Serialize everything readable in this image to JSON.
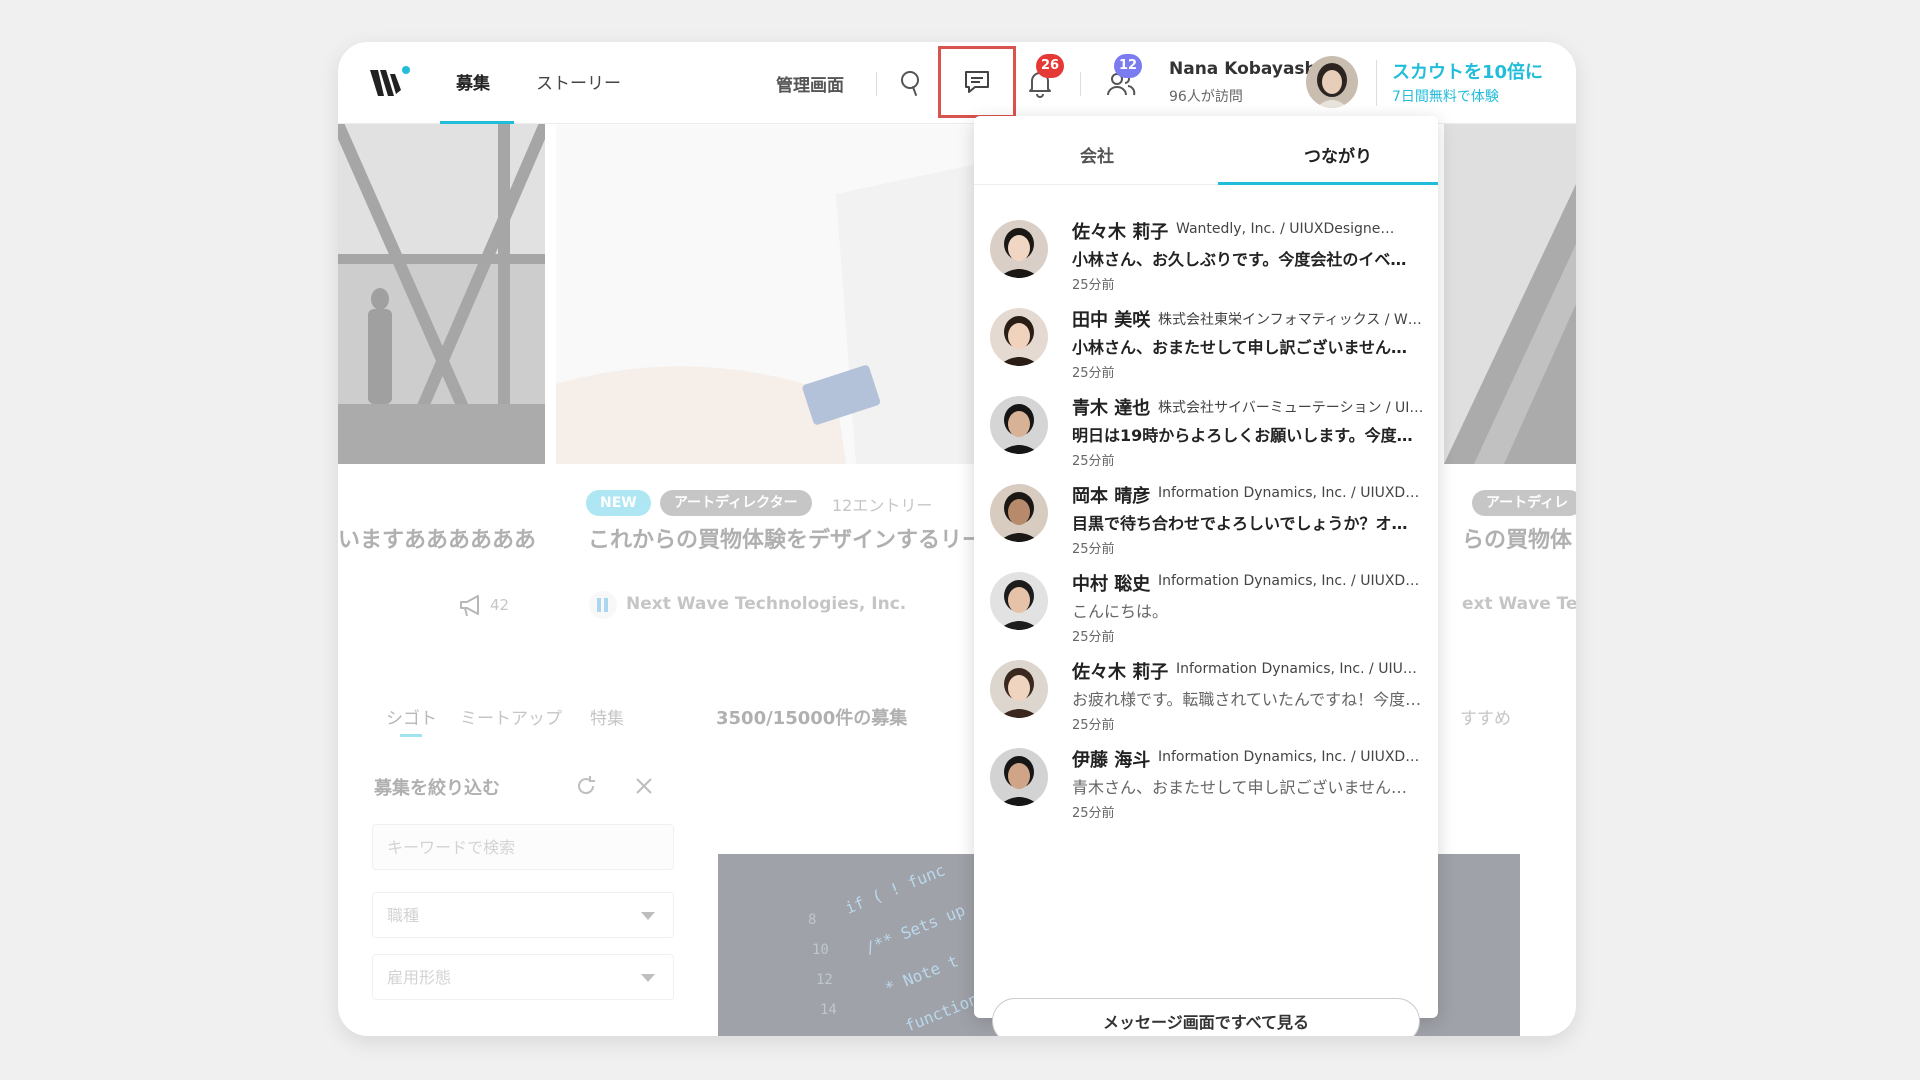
{
  "header": {
    "nav": [
      {
        "label": "募集"
      },
      {
        "label": "ストーリー"
      }
    ],
    "admin_label": "管理画面",
    "notifications_count": "26",
    "connections_count": "12",
    "user": {
      "name": "Nana Kobayashi",
      "visits": "96人が訪問"
    },
    "scout": {
      "title": "スカウトを10倍に",
      "subtitle": "7日間無料で体験"
    },
    "accent_color": "#21bddb",
    "badge_red": "#e53935",
    "badge_purple": "#7b7cf0",
    "highlight_color": "#d9534f"
  },
  "background": {
    "left_card": {
      "title": "いますああああああ",
      "count": "42"
    },
    "center_card": {
      "badge_new": "NEW",
      "tag": "アートディレクター",
      "entries": "12エントリー",
      "title": "これからの買物体験をデザインするリー",
      "company": "Next Wave Technologies, Inc."
    },
    "right_card": {
      "tag": "アートディレ",
      "title": "らの買物体",
      "company": "ext Wave Tec"
    },
    "tabs": [
      {
        "label": "シゴト"
      },
      {
        "label": "ミートアップ"
      },
      {
        "label": "特集"
      }
    ],
    "results": "3500/15000件の募集",
    "recommend": "すすめ",
    "filter": {
      "title": "募集を絞り込む",
      "keyword_placeholder": "キーワードで検索",
      "job_type": "職種",
      "employment": "雇用形態"
    }
  },
  "panel": {
    "tabs": [
      {
        "label": "会社"
      },
      {
        "label": "つながり"
      }
    ],
    "messages": [
      {
        "name": "佐々木 莉子",
        "company": "Wantedly, Inc. / UIUXDesigne…",
        "text": "小林さん、お久しぶりです。今度会社のイベ…",
        "time": "25分前",
        "unread": true
      },
      {
        "name": "田中 美咲",
        "company": "株式会社東栄インフォマティックス / W…",
        "text": "小林さん、おまたせして申し訳ございません…",
        "time": "25分前",
        "unread": true
      },
      {
        "name": "青木 達也",
        "company": "株式会社サイバーミューテーション / UI…",
        "text": "明日は19時からよろしくお願いします。今度…",
        "time": "25分前",
        "unread": true
      },
      {
        "name": "岡本 晴彦",
        "company": "Information Dynamics, Inc. / UIUXD…",
        "text": "目黒で待ち合わせでよろしいでしょうか？オ…",
        "time": "25分前",
        "unread": true
      },
      {
        "name": "中村 聡史",
        "company": "Information Dynamics, Inc. / UIUXD…",
        "text": "こんにちは。",
        "time": "25分前",
        "unread": false
      },
      {
        "name": "佐々木 莉子",
        "company": "Information Dynamics, Inc. / UIU…",
        "text": "お疲れ様です。転職されていたんですね！今度…",
        "time": "25分前",
        "unread": false
      },
      {
        "name": "伊藤 海斗",
        "company": "Information Dynamics, Inc. / UIUXD…",
        "text": "青木さん、おまたせして申し訳ございません…",
        "time": "25分前",
        "unread": false
      }
    ],
    "see_all": "メッセージ画面ですべて見る"
  }
}
